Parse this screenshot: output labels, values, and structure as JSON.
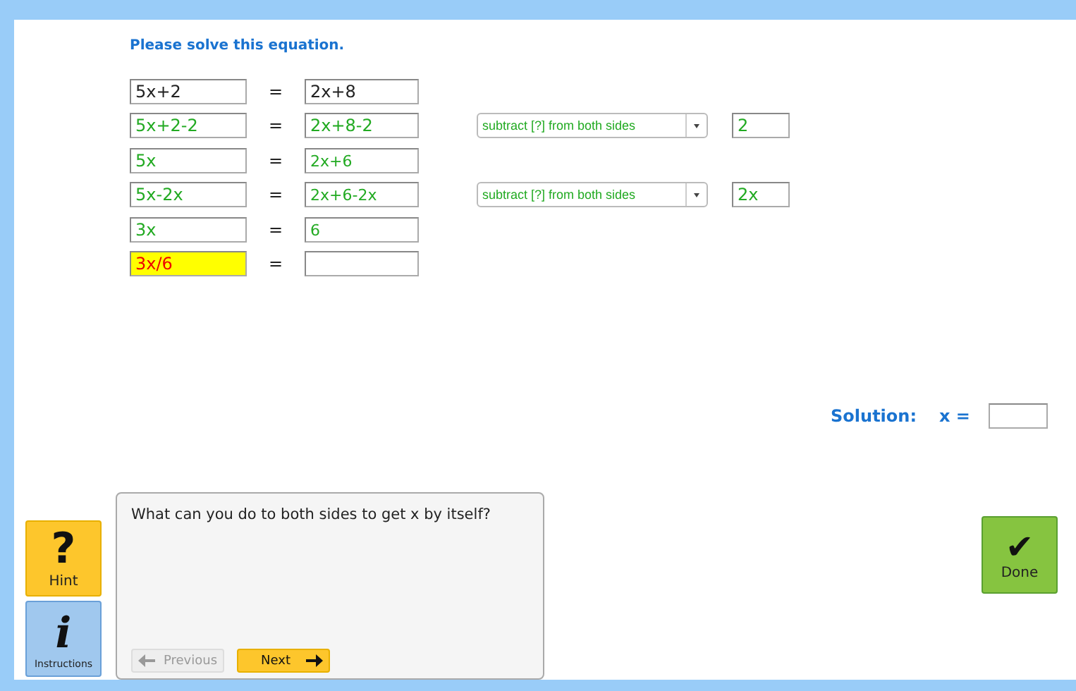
{
  "title": "Please solve this equation.",
  "rows": [
    {
      "kind": "given",
      "left": {
        "text": "5x+2",
        "correct": false,
        "error": false
      },
      "equals": "=",
      "right": {
        "text": "2x+8",
        "correct": false,
        "error": false
      }
    },
    {
      "kind": "step",
      "left": {
        "text": "5x+2-2",
        "correct": true,
        "error": false
      },
      "equals": "=",
      "right": {
        "text": "2x+8-2",
        "correct": true,
        "error": false
      },
      "action": "subtract [?] from both sides",
      "amount": "2"
    },
    {
      "kind": "given",
      "left": {
        "text": "5x",
        "correct": true,
        "error": false
      },
      "equals": "=",
      "right": {
        "text": "2x+6",
        "correct": true,
        "error": false
      }
    },
    {
      "kind": "step",
      "left": {
        "text": "5x-2x",
        "correct": true,
        "error": false
      },
      "equals": "=",
      "right": {
        "text": "2x+6-2x",
        "correct": true,
        "error": false
      },
      "action": "subtract [?] from both sides",
      "amount": "2x"
    },
    {
      "kind": "given",
      "left": {
        "text": "3x",
        "correct": true,
        "error": false
      },
      "equals": "=",
      "right": {
        "text": "6",
        "correct": true,
        "error": false
      }
    },
    {
      "kind": "given",
      "left": {
        "text": "3x/6",
        "correct": false,
        "error": true
      },
      "equals": "="
    }
  ],
  "solution": {
    "label": "Solution:",
    "variable": "x ="
  },
  "hint_button": {
    "symbol": "?",
    "label": "Hint"
  },
  "instructions_button": {
    "symbol": "i",
    "label": "Instructions"
  },
  "feedback": {
    "message": "What can you do to both sides to get x by itself?",
    "previous": {
      "label": "Previous",
      "disabled": true
    },
    "next": {
      "label": "Next",
      "disabled": false
    }
  },
  "done_button": {
    "symbol": "✔",
    "label": "Done"
  }
}
